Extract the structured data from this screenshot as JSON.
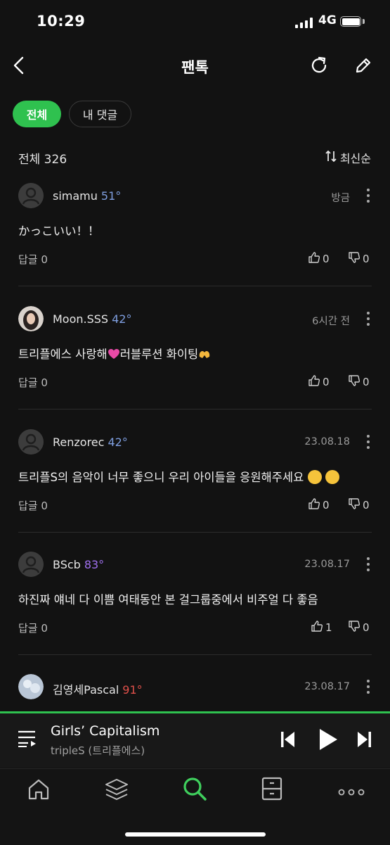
{
  "status_bar": {
    "time": "10:29",
    "network": "4G"
  },
  "header": {
    "title": "팬톡"
  },
  "tabs": [
    {
      "label": "전체",
      "active": true
    },
    {
      "label": "내 댓글",
      "active": false
    }
  ],
  "summary": {
    "total_label": "전체 326",
    "sort_label": "최신순"
  },
  "comments": [
    {
      "user": "simamu",
      "level": "51°",
      "level_color": "#7f9fe0",
      "date": "방금",
      "text": "かっこいい！！",
      "reply": "답글 0",
      "likes": "0",
      "dislikes": "0"
    },
    {
      "user": "Moon.SSS",
      "level": "42°",
      "level_color": "#7f9fe0",
      "date": "6시간 전",
      "text_before": "트리플에스 사랑해",
      "text_after": "러블루션 화이팅",
      "reply": "답글 0",
      "likes": "0",
      "dislikes": "0"
    },
    {
      "user": "Renzorec",
      "level": "42°",
      "level_color": "#7f9fe0",
      "date": "23.08.18",
      "text": "트리플S의 음악이 너무 좋으니 우리 아이들을 응원해주세요",
      "reply": "답글 0",
      "likes": "0",
      "dislikes": "0"
    },
    {
      "user": "BScb",
      "level": "83°",
      "level_color": "#a070f0",
      "date": "23.08.17",
      "text": "하진짜 얘네 다 이쁨 여태동안 본 걸그룹중에서 비주얼 다 좋음",
      "reply": "답글 0",
      "likes": "1",
      "dislikes": "0"
    },
    {
      "user": "김영세Pascal",
      "level": "91°",
      "level_color": "#e0504a",
      "date": "23.08.17"
    }
  ],
  "player": {
    "song": "Girls’ Capitalism",
    "artist": "tripleS (트리플에스)"
  },
  "colors": {
    "accent": "#2fc14f",
    "background": "#121212"
  },
  "nav": [
    "home-icon",
    "library-icon",
    "search-icon",
    "storage-icon",
    "more-icon"
  ]
}
